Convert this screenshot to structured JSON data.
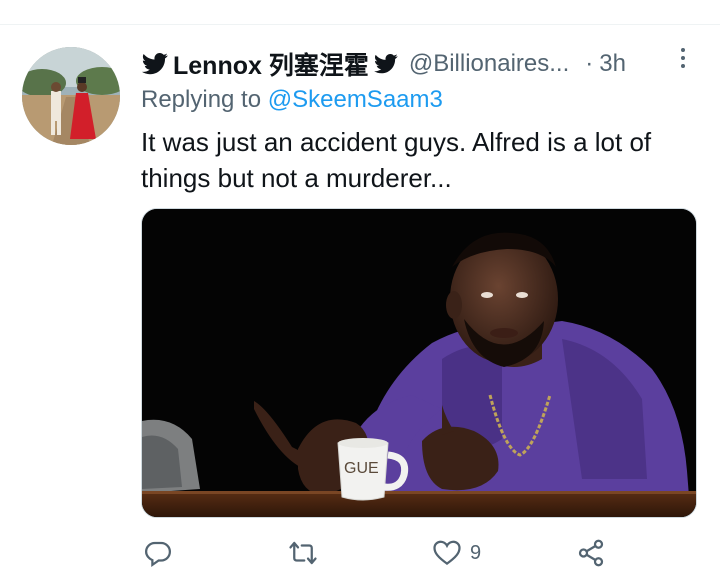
{
  "tweet": {
    "author_name": "Lennox 列塞涅霍",
    "author_handle": "@Billionaires...",
    "separator": "·",
    "time": "3h",
    "reply_prefix": "Replying to",
    "reply_to": "@SkeemSaam3",
    "text": "It was just an accident guys. Alfred is a lot of things but not a murderer...",
    "image_mug_text": "GUE"
  },
  "actions": {
    "reply_count": "",
    "retweet_count": "",
    "like_count": "9",
    "share_count": ""
  },
  "colors": {
    "text_primary": "#0f1419",
    "text_secondary": "#536471",
    "link": "#1d9bf0",
    "shirt": "#5b3f9e"
  }
}
